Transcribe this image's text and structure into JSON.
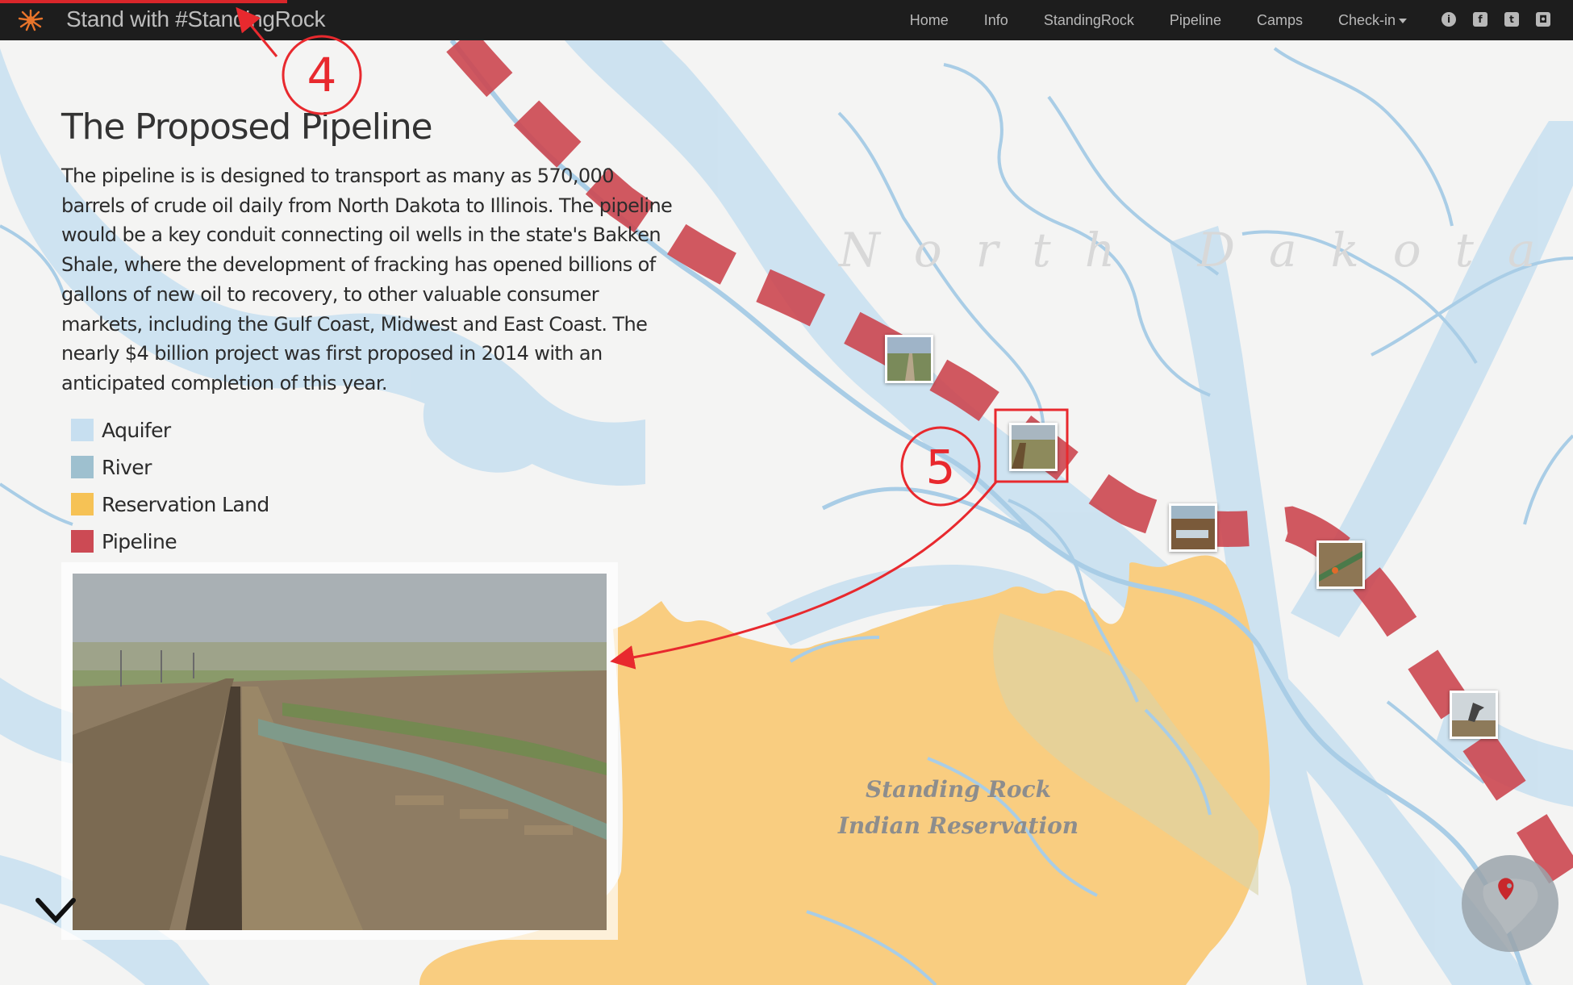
{
  "navbar": {
    "title": "Stand with #StandingRock",
    "links": [
      "Home",
      "Info",
      "StandingRock",
      "Pipeline",
      "Camps",
      "Check-in"
    ],
    "icons": [
      "info-icon",
      "facebook-icon",
      "twitter-icon",
      "instagram-icon"
    ],
    "progress": 0.18
  },
  "content": {
    "title": "The Proposed Pipeline",
    "description": "The pipeline is is designed to transport as many as 570,000 barrels of crude oil daily from North Dakota to Illinois. The pipeline would be a key conduit connecting oil wells in the state's Bakken Shale, where the development of fracking has opened billions of gallons of new oil to recovery, to other valuable consumer markets, including the Gulf Coast, Midwest and East Coast. The nearly $4 billion project was first proposed in 2014 with an anticipated completion of this year."
  },
  "legend": [
    {
      "label": "Aquifer",
      "color": "#c7dff0"
    },
    {
      "label": "River",
      "color": "#9ec0cf"
    },
    {
      "label": "Reservation Land",
      "color": "#f6c255"
    },
    {
      "label": "Pipeline",
      "color": "#cc4a54"
    }
  ],
  "map": {
    "state_label": "North Dakota",
    "reservation_label_line1": "Standing Rock",
    "reservation_label_line2": "Indian Reservation",
    "colors": {
      "background": "#f4f4f3",
      "aquifer": "#c7dff0",
      "river": "#a9cde6",
      "reservation": "#f9cd80",
      "pipeline": "#cc4a54"
    }
  },
  "annotations": {
    "label_4": "4",
    "label_5": "5",
    "color": "#e8292e"
  }
}
